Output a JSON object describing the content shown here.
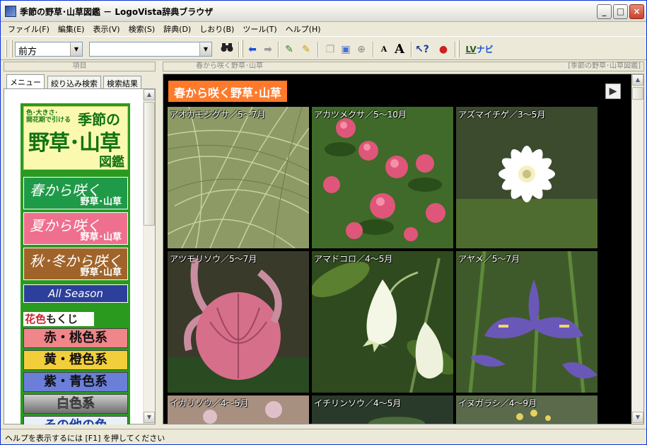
{
  "window": {
    "title": "季節の野草･山草図鑑 － LogoVista辞典ブラウザ"
  },
  "menu": [
    "ファイル(F)",
    "編集(E)",
    "表示(V)",
    "検索(S)",
    "辞典(D)",
    "しおり(B)",
    "ツール(T)",
    "ヘルプ(H)"
  ],
  "toolbar": {
    "nav_combo_value": "前方",
    "search_combo_value": "",
    "lvnavi_label": "ナビ",
    "lv_label": "LV",
    "font_small": "A",
    "font_large": "A"
  },
  "headers": {
    "left": "項目",
    "main_left": "春から咲く野草･山草",
    "main_right": "[季節の野草･山草図鑑]"
  },
  "tabs": [
    "メニュー",
    "絞り込み検索",
    "検索結果"
  ],
  "left_menu": {
    "logo_small_1": "色･大きさ･",
    "logo_small_2": "開花期で引ける",
    "logo_season": "季節の",
    "logo_big": "野草･山草",
    "logo_zukan": "図鑑",
    "seasons": [
      {
        "top": "春から咲く",
        "bottom": "野草･山草",
        "color": "#1f9a48"
      },
      {
        "top": "夏から咲く",
        "bottom": "野草･山草",
        "color": "#ef6f8e"
      },
      {
        "top": "秋･冬から咲く",
        "bottom": "野草･山草",
        "color": "#a0642a"
      }
    ],
    "all_season": "All Season",
    "color_head_a": "花色",
    "color_head_b": "もくじ",
    "colors": [
      {
        "label": "赤・桃色系",
        "color": "#f0868a"
      },
      {
        "label": "黄・橙色系",
        "color": "#f2cf3a"
      },
      {
        "label": "紫・青色系",
        "color": "#6b7fd9"
      },
      {
        "label": "白色系",
        "color": "#9a9a9a"
      },
      {
        "label": "その他の色",
        "color": "#e8f0f8"
      }
    ]
  },
  "main": {
    "section_title": "春から咲く野草･山草",
    "plants": [
      "アオカモジグサ／5～7月",
      "アカツメクサ／5～10月",
      "アズマイチゲ／3～5月",
      "アツモリソウ／5～7月",
      "アマドコロ／4～5月",
      "アヤメ／5～7月",
      "イカリソウ／4～5月",
      "イチリンソウ／4～5月",
      "イヌガラシ／4～9月"
    ]
  },
  "status": {
    "text": "ヘルプを表示するには [F1] を押してください"
  }
}
